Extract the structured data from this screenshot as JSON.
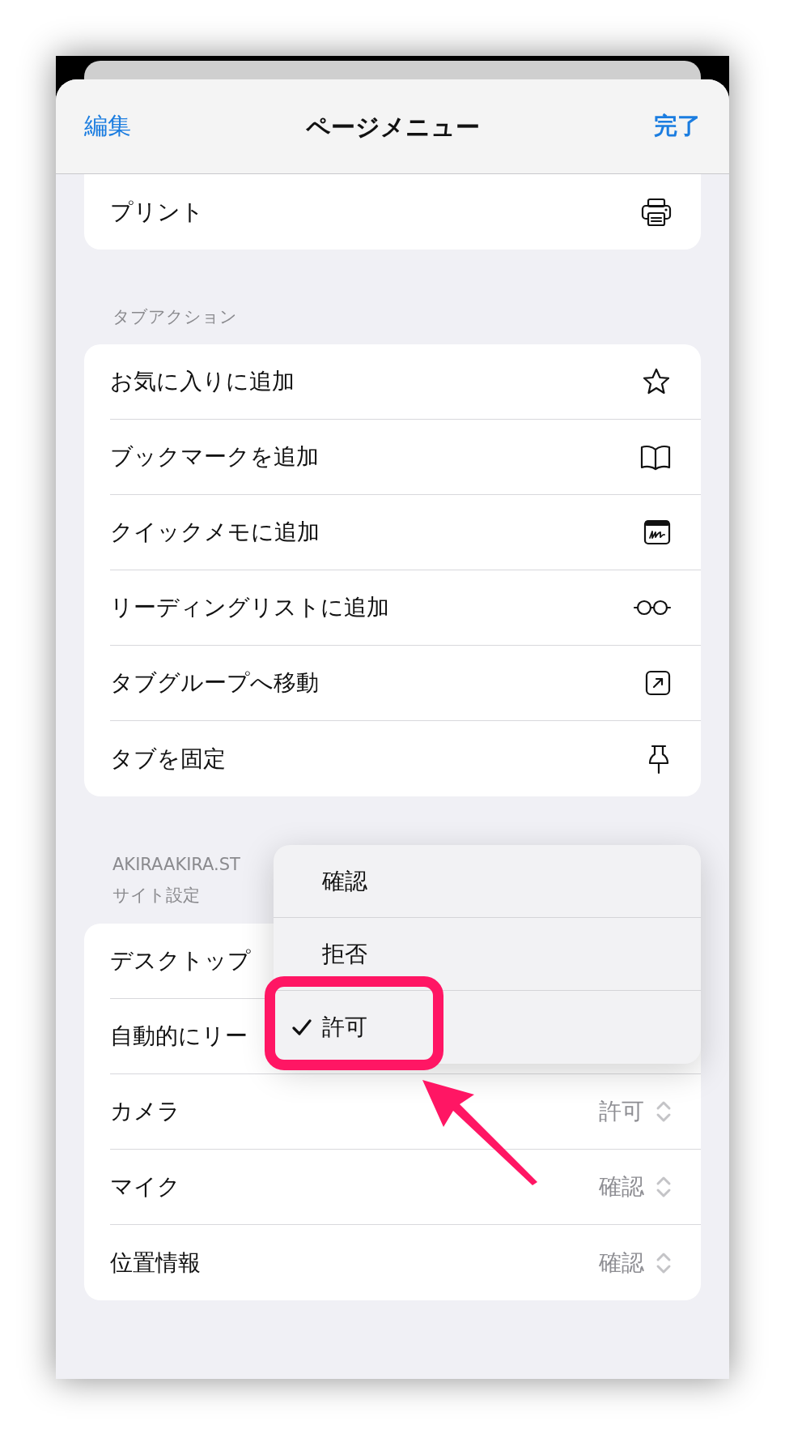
{
  "header": {
    "left_button": "編集",
    "title": "ページメニュー",
    "right_button": "完了"
  },
  "top_card": {
    "rows": [
      {
        "kind": "action",
        "label": "プリント"
      }
    ]
  },
  "tab_actions": {
    "heading": "タブアクション",
    "rows": [
      {
        "kind": "action",
        "label": "お気に入りに追加"
      },
      {
        "kind": "action",
        "label": "ブックマークを追加"
      },
      {
        "kind": "action",
        "label": "クイックメモに追加"
      },
      {
        "kind": "action",
        "label": "リーディングリストに追加"
      },
      {
        "kind": "action",
        "label": "タブグループへ移動"
      },
      {
        "kind": "action",
        "label": "タブを固定"
      }
    ]
  },
  "site_settings": {
    "domain": "AKIRAAKIRA.ST",
    "heading": "サイト設定",
    "rows": [
      {
        "kind": "covered",
        "label": "デスクトップ"
      },
      {
        "kind": "covered",
        "label": "自動的にリー"
      },
      {
        "kind": "select",
        "label": "カメラ",
        "value": "許可"
      },
      {
        "kind": "select",
        "label": "マイク",
        "value": "確認"
      },
      {
        "kind": "select",
        "label": "位置情報",
        "value": "確認"
      }
    ]
  },
  "popup_menu": {
    "options": [
      {
        "label": "確認",
        "selected": false
      },
      {
        "label": "拒否",
        "selected": false
      },
      {
        "label": "許可",
        "selected": true
      }
    ]
  }
}
